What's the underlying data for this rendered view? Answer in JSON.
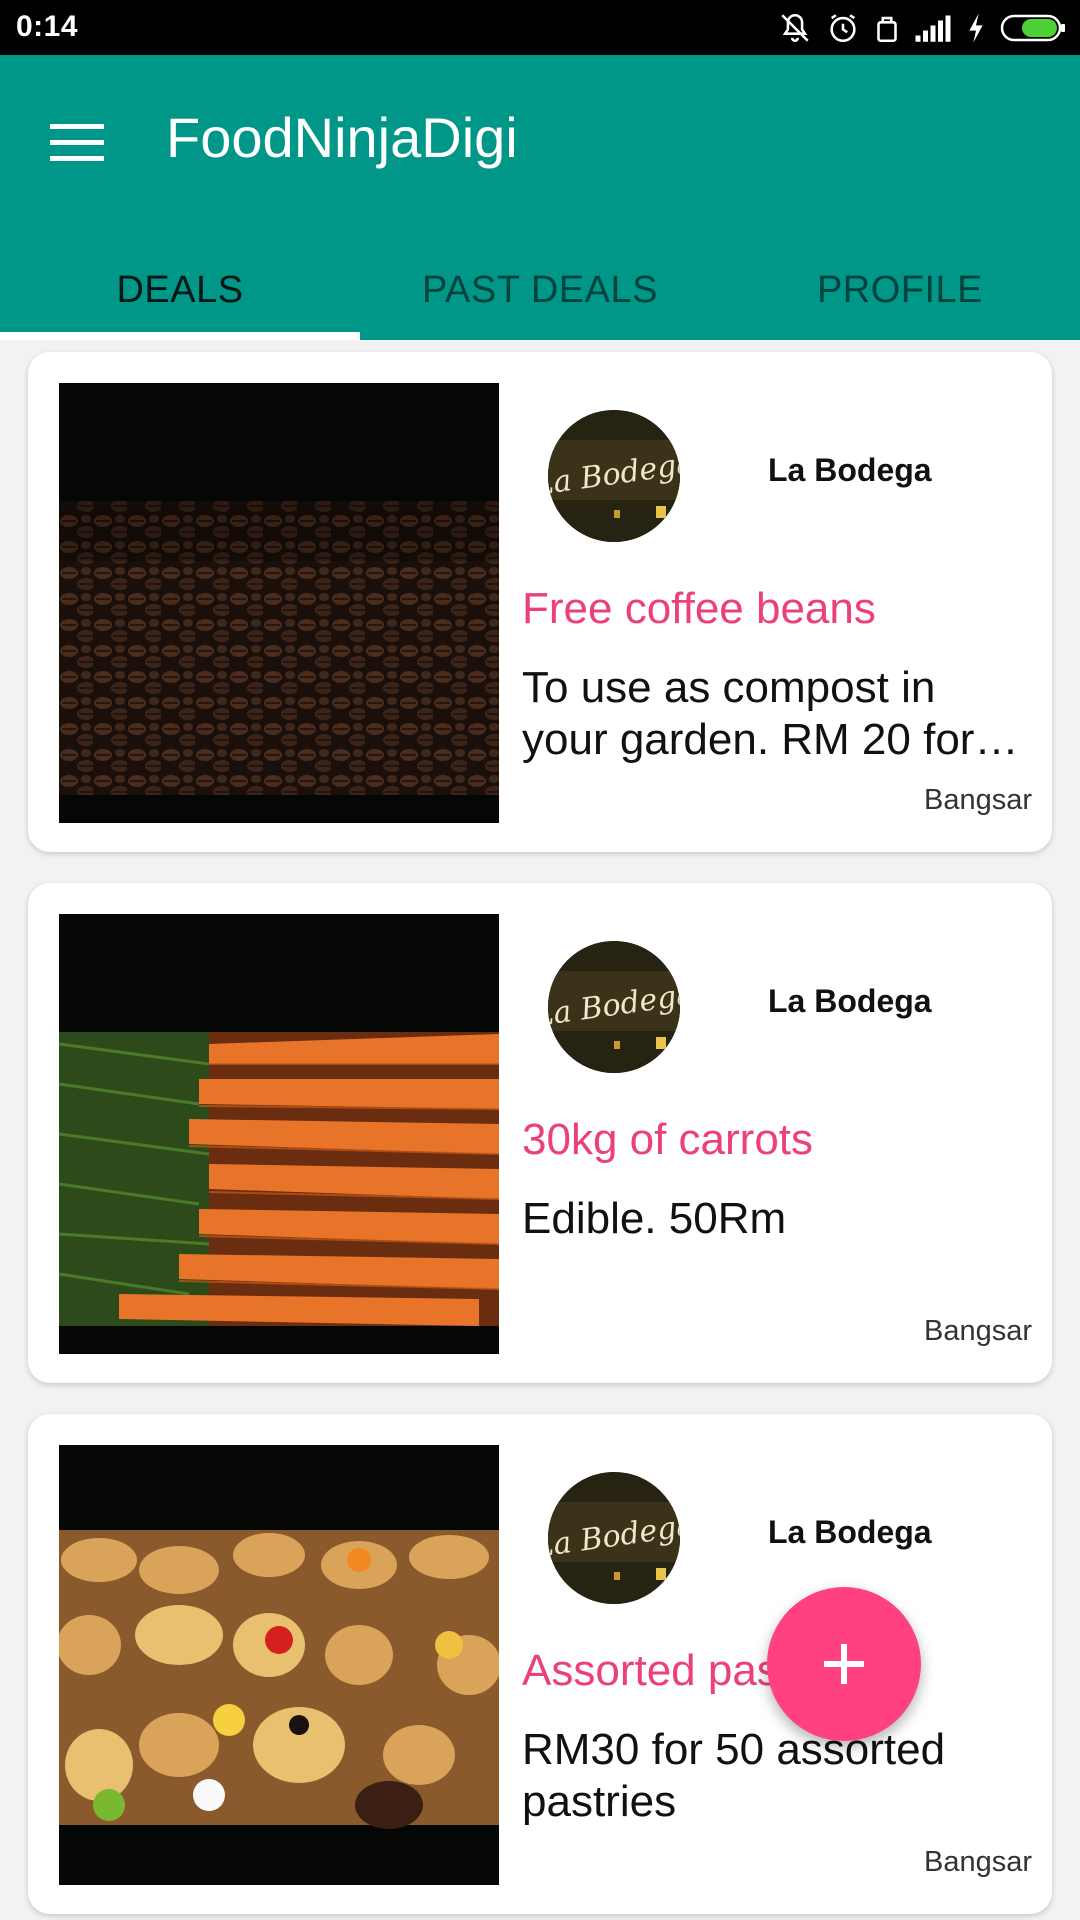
{
  "status_bar": {
    "time": "0:14"
  },
  "app_bar": {
    "title": "FoodNinjaDigi"
  },
  "tabs": [
    {
      "label": "DEALS",
      "active": true
    },
    {
      "label": "PAST DEALS",
      "active": false
    },
    {
      "label": "PROFILE",
      "active": false
    }
  ],
  "deals": [
    {
      "venue": "La Bodega",
      "title": "Free coffee beans",
      "description": "To use as compost in your garden.  RM 20 for…",
      "location": "Bangsar",
      "image": "coffee-beans"
    },
    {
      "venue": "La Bodega",
      "title": "30kg of carrots",
      "description": "Edible.  50Rm",
      "location": "Bangsar",
      "image": "carrots"
    },
    {
      "venue": "La Bodega",
      "title": "Assorted pastries",
      "description": "RM30 for 50 assorted pastries",
      "location": "Bangsar",
      "image": "pastries"
    }
  ],
  "fab": {
    "icon": "plus-icon"
  },
  "colors": {
    "primary": "#009688",
    "accent": "#ff4081",
    "deal_title": "#ec407a"
  }
}
